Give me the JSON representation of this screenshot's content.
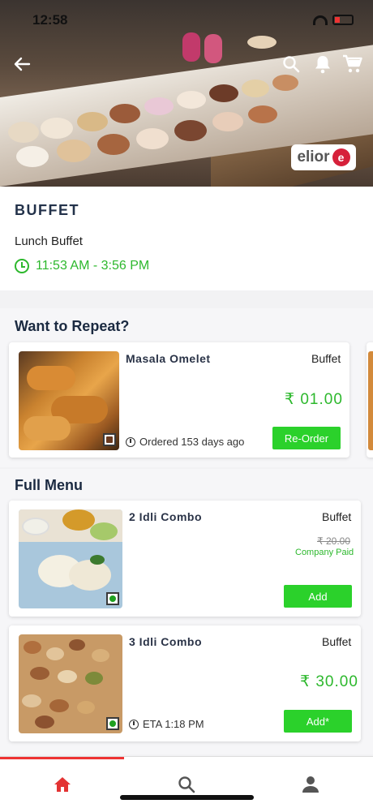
{
  "status": {
    "time": "12:58"
  },
  "header": {
    "brand_logo": "elior"
  },
  "outlet": {
    "title": "BUFFET",
    "subtitle": "Lunch Buffet",
    "hours": "11:53 AM - 3:56 PM"
  },
  "repeat": {
    "title": "Want to Repeat?",
    "items": [
      {
        "name": "Masala Omelet",
        "tag": "Buffet",
        "price": "₹ 01.00",
        "meta": "Ordered 153 days ago",
        "button": "Re-Order",
        "diet": "non-veg"
      }
    ]
  },
  "menu": {
    "title": "Full Menu",
    "items": [
      {
        "name": "2 Idli Combo",
        "tag": "Buffet",
        "price_strike": "₹ 20.00",
        "note": "Company Paid",
        "button": "Add",
        "diet": "veg"
      },
      {
        "name": "3 Idli Combo",
        "tag": "Buffet",
        "price": "₹ 30.00",
        "meta": "ETA 1:18 PM",
        "button": "Add*",
        "diet": "veg"
      }
    ]
  },
  "nav": {
    "items": [
      "home-icon",
      "search-icon",
      "profile-icon"
    ],
    "active": "home",
    "accent": "#e33333"
  },
  "colors": {
    "accent_green": "#2db82d",
    "button_green": "#2bd12b",
    "title_navy": "#23324a"
  }
}
